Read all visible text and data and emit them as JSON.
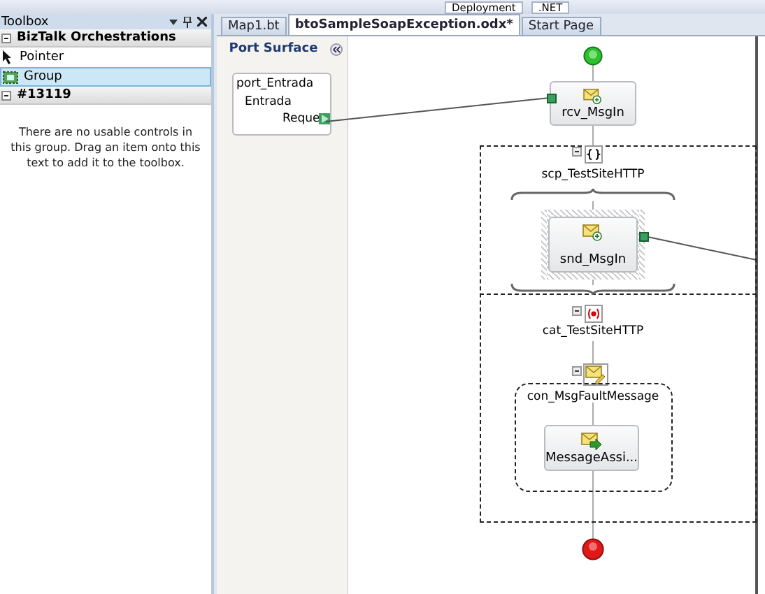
{
  "toolbar": {
    "items": [
      "Deployment",
      ".NET"
    ]
  },
  "toolbox": {
    "title": "Toolbox",
    "groups": [
      {
        "name": "BizTalk Orchestrations",
        "expanded": true,
        "items": [
          {
            "label": "Pointer",
            "kind": "pointer",
            "selected": false
          },
          {
            "label": "Group",
            "kind": "group",
            "selected": true
          }
        ]
      },
      {
        "name": "#13119",
        "expanded": true,
        "empty_message": "There are no usable controls in this group. Drag an item onto this text to add it to the toolbox."
      }
    ]
  },
  "tabs": [
    {
      "label": "Map1.bt",
      "selected": false
    },
    {
      "label": "btoSampleSoapException.odx*",
      "selected": true
    },
    {
      "label": "Start Page",
      "selected": false
    }
  ],
  "port_surface": {
    "title": "Port Surface",
    "ports": [
      {
        "name": "port_Entrada",
        "operation": "Entrada",
        "message": "Reque"
      }
    ]
  },
  "orchestration": {
    "receive": {
      "label": "rcv_MsgIn",
      "kind": "receive"
    },
    "scope": {
      "label": "scp_TestSiteHTTP",
      "body": {
        "label": "snd_MsgIn",
        "kind": "send",
        "selected": true
      }
    },
    "catch": {
      "label": "cat_TestSiteHTTP",
      "construct": {
        "label": "con_MsgFaultMessage",
        "body": {
          "label": "MessageAssi...",
          "kind": "assign",
          "selected": false
        }
      }
    }
  }
}
